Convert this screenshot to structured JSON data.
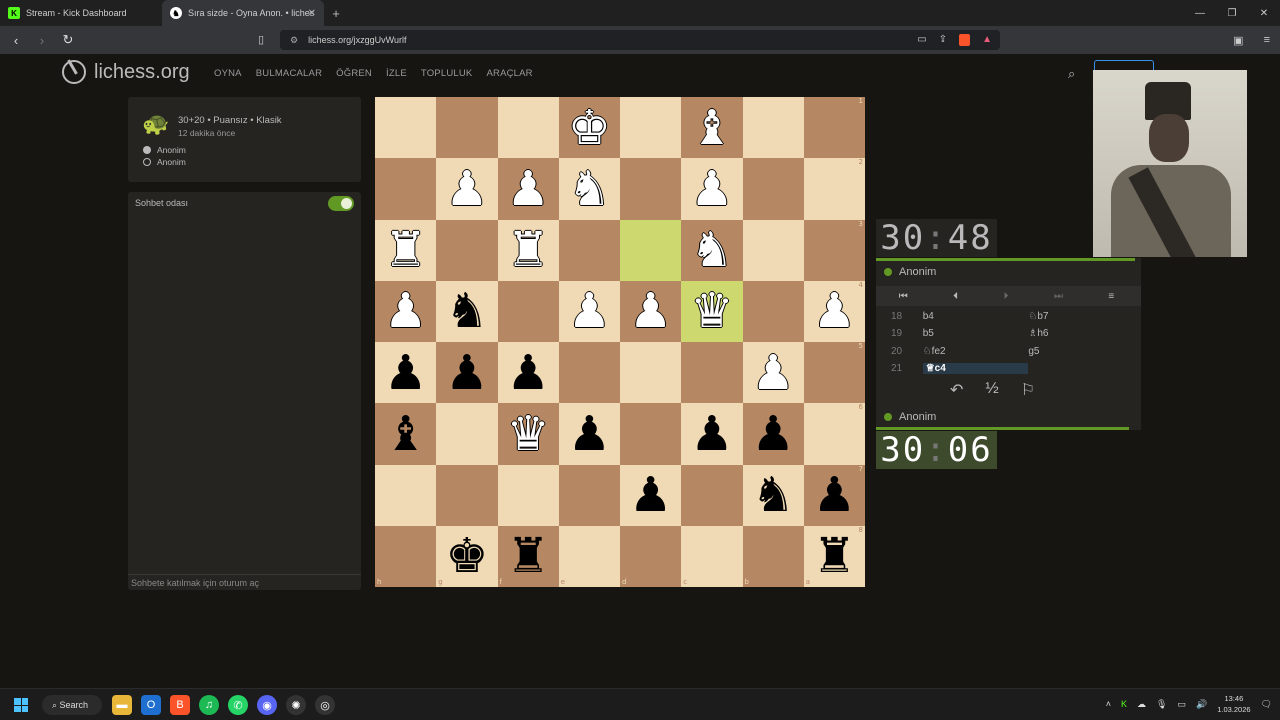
{
  "browser": {
    "tabs": [
      {
        "title": "Stream - Kick Dashboard",
        "active": false
      },
      {
        "title": "Sıra sizde - Oyna Anon. • liches",
        "active": true
      }
    ],
    "url": "lichess.org/jxzggUvWurlf"
  },
  "site": {
    "logo": "lichess.org",
    "nav": [
      "OYNA",
      "BULMACALAR",
      "ÖĞREN",
      "İZLE",
      "TOPLULUK",
      "ARAÇLAR"
    ]
  },
  "game": {
    "title": "30+20 • Puansız • Klasik",
    "time_ago": "12 dakika önce",
    "white_player": "Anonim",
    "black_player": "Anonim"
  },
  "chat": {
    "title": "Sohbet odası",
    "input_placeholder": "Sohbete katılmak için oturum aç",
    "enabled": true
  },
  "board": {
    "orientation": "black",
    "ranks": [
      "1",
      "2",
      "3",
      "4",
      "5",
      "6",
      "7",
      "8"
    ],
    "files": [
      "h",
      "g",
      "f",
      "e",
      "d",
      "c",
      "b",
      "a"
    ],
    "rows": [
      [
        "",
        "",
        "",
        "wK",
        "",
        "wB",
        "",
        ""
      ],
      [
        "",
        "wP",
        "wP",
        "wN",
        "",
        "wP",
        "",
        ""
      ],
      [
        "wR",
        "",
        "wR",
        "",
        "",
        "wN",
        "",
        ""
      ],
      [
        "wP",
        "bN",
        "",
        "wP",
        "wP",
        "wQ",
        "",
        "wP"
      ],
      [
        "bP",
        "bP",
        "bP",
        "",
        "",
        "",
        "wP",
        ""
      ],
      [
        "bB",
        "",
        "wQ",
        "bP",
        "",
        "bP",
        "bP",
        ""
      ],
      [
        "",
        "",
        "",
        "",
        "bP",
        "",
        "bN",
        "bP"
      ],
      [
        "",
        "bK",
        "bR",
        "",
        "",
        "",
        "",
        "bR"
      ]
    ],
    "highlights": [
      [
        2,
        4
      ],
      [
        3,
        5
      ]
    ]
  },
  "clocks": {
    "top": {
      "min": "30",
      "sec": "48",
      "player": "Anonim"
    },
    "bottom": {
      "min": "30",
      "sec": "06",
      "player": "Anonim"
    }
  },
  "moves": [
    {
      "n": "18",
      "w": "b4",
      "b": "♘b7"
    },
    {
      "n": "19",
      "w": "b5",
      "b": "♗h6"
    },
    {
      "n": "20",
      "w": "♘fe2",
      "b": "g5"
    },
    {
      "n": "21",
      "w": "♕c4",
      "b": ""
    }
  ],
  "controls": {
    "first": "⏮",
    "prev": "⏴",
    "next": "⏵",
    "last": "⏭",
    "menu": "≡"
  },
  "actions": {
    "takeback": "↶",
    "draw": "½",
    "resign": "⚐"
  },
  "taskbar": {
    "search": "Search",
    "time": "13:46",
    "date": "1.03.2026"
  }
}
